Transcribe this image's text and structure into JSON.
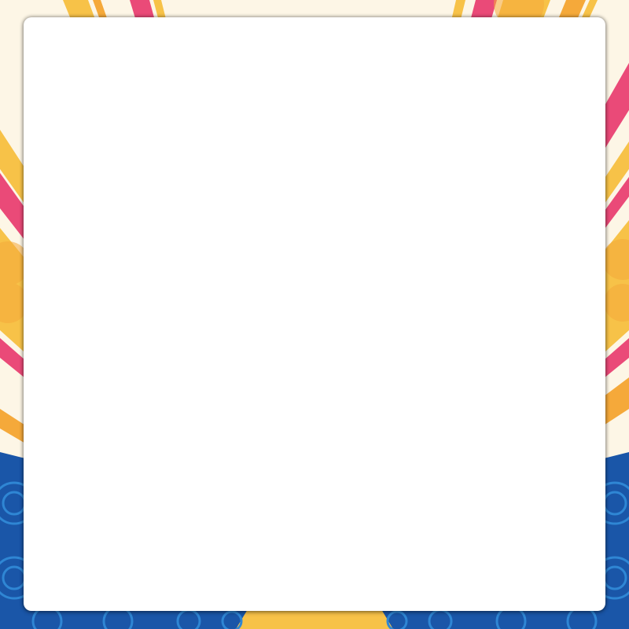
{
  "background": {
    "theme": "sunburst-rays-over-speaker-wall",
    "colors": {
      "cream": "#fdf6e6",
      "yellow": "#f7c248",
      "orange": "#f5a93a",
      "pink": "#ea4a78",
      "blue": "#1a56a8",
      "blue_light": "#2f86d4"
    }
  },
  "card": {
    "color": "#ffffff",
    "content": ""
  }
}
